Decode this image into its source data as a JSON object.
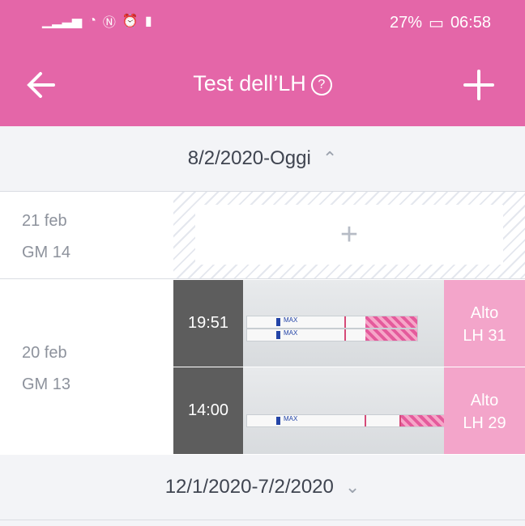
{
  "status": {
    "battery": "27%",
    "time": "06:58"
  },
  "header": {
    "title": "Test dell’LH",
    "help": "?"
  },
  "ranges": [
    {
      "label": "8/2/2020-Oggi",
      "chevron": "⌃"
    },
    {
      "label": "12/1/2020-7/2/2020",
      "chevron": "⌄"
    }
  ],
  "days": [
    {
      "date": "21 feb",
      "cycle_day": "GM 14",
      "add_label": "+"
    },
    {
      "date": "20 feb",
      "cycle_day": "GM 13",
      "tests": [
        {
          "time": "19:51",
          "result": "Alto",
          "lh": "LH 31"
        },
        {
          "time": "14:00",
          "result": "Alto",
          "lh": "LH 29"
        }
      ]
    }
  ],
  "strip_text": "MAX"
}
